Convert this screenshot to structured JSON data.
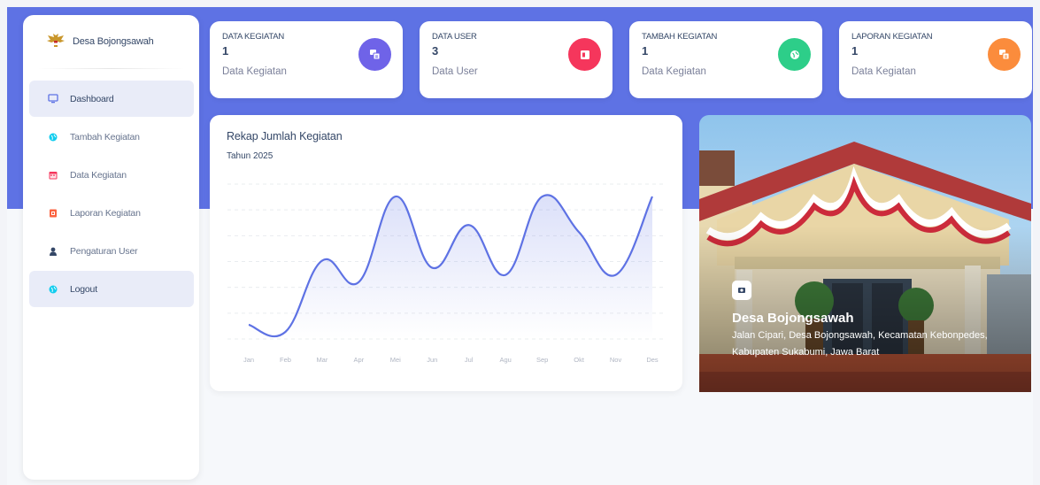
{
  "sidebar": {
    "brand": "Desa Bojongsawah",
    "items": [
      {
        "label": "Dashboard",
        "icon": "monitor-icon",
        "active": true
      },
      {
        "label": "Tambah Kegiatan",
        "icon": "globe-icon"
      },
      {
        "label": "Data Kegiatan",
        "icon": "calendar-icon"
      },
      {
        "label": "Laporan Kegiatan",
        "icon": "report-icon"
      },
      {
        "label": "Pengaturan User",
        "icon": "user-icon"
      },
      {
        "label": "Logout",
        "icon": "logout-icon"
      }
    ]
  },
  "stats": [
    {
      "title": "DATA KEGIATAN",
      "value": "1",
      "sub": "Data Kegiatan",
      "color": "#6f63e8",
      "icon": "layers-icon"
    },
    {
      "title": "DATA USER",
      "value": "3",
      "sub": "Data User",
      "color": "#f5365c",
      "icon": "id-card-icon"
    },
    {
      "title": "TAMBAH KEGIATAN",
      "value": "1",
      "sub": "Data Kegiatan",
      "color": "#2dce89",
      "icon": "globe-icon"
    },
    {
      "title": "LAPORAN KEGIATAN",
      "value": "1",
      "sub": "Data Kegiatan",
      "color": "#fb8c3c",
      "icon": "layers-icon"
    }
  ],
  "chart": {
    "title": "Rekap Jumlah Kegiatan",
    "subtitle": "Tahun 2025"
  },
  "chart_data": {
    "type": "line",
    "categories": [
      "Jan",
      "Feb",
      "Mar",
      "Apr",
      "Mei",
      "Jun",
      "Jul",
      "Agu",
      "Sep",
      "Okt",
      "Nov",
      "Des"
    ],
    "values": [
      0.1,
      0.0,
      1.0,
      0.7,
      1.9,
      0.9,
      1.5,
      0.8,
      1.9,
      1.4,
      0.8,
      1.9
    ],
    "ylim": [
      0,
      2
    ],
    "grid": true,
    "color": "#5e72e4"
  },
  "photo": {
    "title": "Desa Bojongsawah",
    "address": "Jalan Cipari, Desa Bojongsawah, Kecamatan Kebonpedes, Kabupaten Sukabumi, Jawa Barat"
  }
}
